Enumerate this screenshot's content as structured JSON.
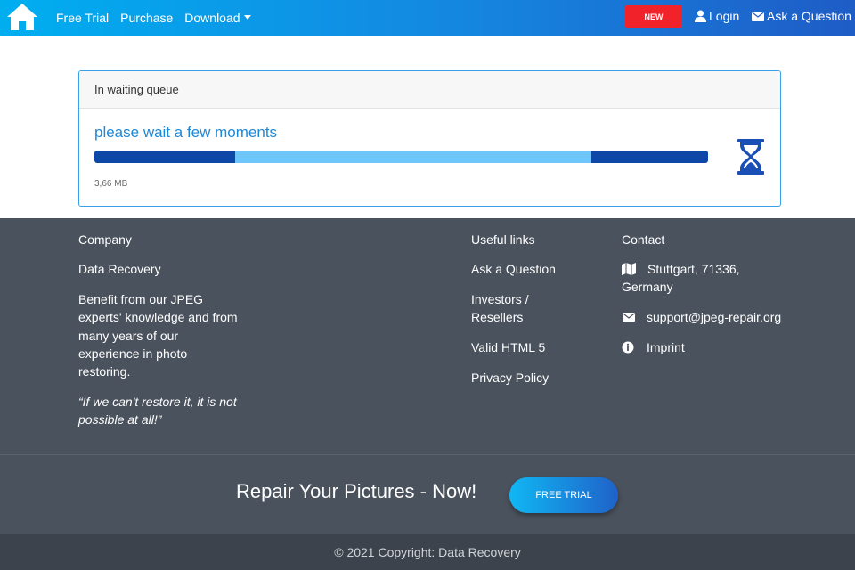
{
  "nav": {
    "links": [
      {
        "label": "Free Trial"
      },
      {
        "label": "Purchase"
      },
      {
        "label": "Download"
      }
    ],
    "new_badge": "NEW",
    "login": "Login",
    "ask": "Ask a Question"
  },
  "queue": {
    "header": "In waiting queue",
    "message": "please wait a few moments",
    "file_size": "3,66 MB",
    "progress_segment_start": 0.23,
    "progress_segment_end": 0.81
  },
  "footer": {
    "company": {
      "heading": "Company",
      "name": "Data Recovery",
      "desc_lines": [
        "Benefit from our JPEG",
        "experts' knowledge and from",
        "many years of our",
        "experience in photo",
        "restoring."
      ],
      "quote_lines": [
        "“If we can't restore it, it is not",
        "possible at all!”"
      ]
    },
    "links": {
      "heading": "Useful links",
      "ask": "Ask a Question",
      "investors_lines": [
        "Investors /",
        "Resellers"
      ],
      "html5": "Valid HTML 5",
      "privacy": "Privacy Policy"
    },
    "contact": {
      "heading": "Contact",
      "address_lines": [
        "Stuttgart, 71336,",
        "Germany"
      ],
      "email": "support@jpeg-repair.org",
      "imprint": "Imprint"
    }
  },
  "cta": {
    "text": "Repair Your Pictures - Now!",
    "button": "FREE TRIAL"
  },
  "copyright": "© 2021 Copyright: Data Recovery",
  "colors": {
    "accent": "#1e88d8",
    "bar_dark": "#0e47a6",
    "bar_light": "#6ec6f8",
    "footer_bg": "#4a525d",
    "badge_red": "#f2222b"
  }
}
